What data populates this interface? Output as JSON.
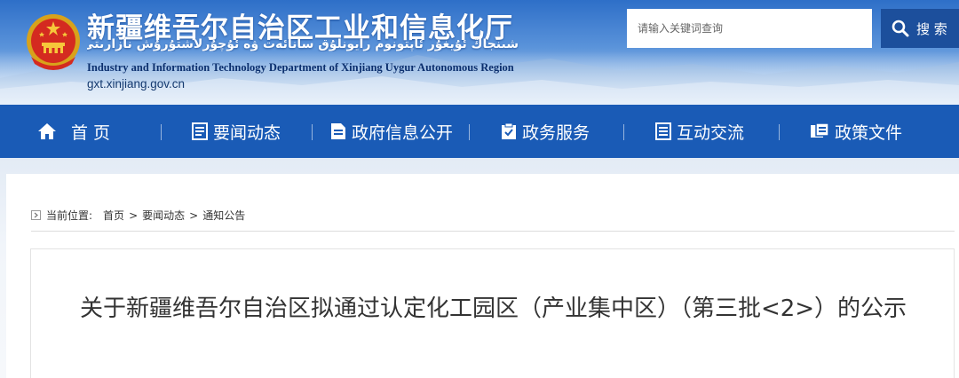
{
  "header": {
    "title_cn": "新疆维吾尔自治区工业和信息化厅",
    "title_uyghur": "شىنجاڭ ئۇيغۇر ئاپتونوم رايونلۇق سانائەت ۋە ئۇچۇرلاشتۇرۇش نازارىتى",
    "title_en": "Industry and Information Technology Department of Xinjiang Uygur Autonomous Region",
    "domain": "gxt.xinjiang.gov.cn",
    "emblem_icon": "national-emblem"
  },
  "search": {
    "placeholder": "请输入关键词查询",
    "button_label": "搜 索",
    "icon": "search-icon"
  },
  "nav": {
    "items": [
      {
        "label": "首 页",
        "icon": "home-icon"
      },
      {
        "label": "要闻动态",
        "icon": "news-icon"
      },
      {
        "label": "政府信息公开",
        "icon": "document-icon"
      },
      {
        "label": "政务服务",
        "icon": "service-icon"
      },
      {
        "label": "互动交流",
        "icon": "chat-list-icon"
      },
      {
        "label": "政策文件",
        "icon": "policy-icon"
      }
    ]
  },
  "breadcrumb": {
    "label": "当前位置:",
    "items": [
      "首页",
      "要闻动态",
      "通知公告"
    ],
    "separator": ">"
  },
  "article": {
    "title": "关于新疆维吾尔自治区拟通过认定化工园区（产业集中区）（第三批<2>）的公示"
  },
  "colors": {
    "nav_bg": "#1a5bb6",
    "search_button_bg": "#1c4f9c",
    "title_text": "#333333"
  }
}
